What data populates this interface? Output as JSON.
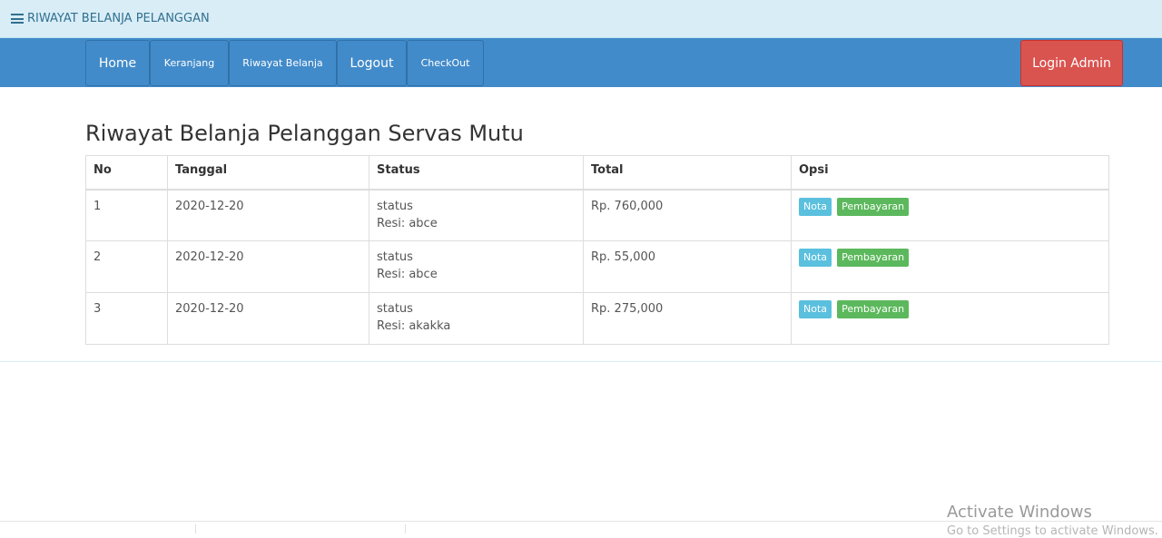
{
  "header": {
    "title": "RIWAYAT BELANJA PELANGGAN"
  },
  "nav": {
    "items": [
      {
        "label": "Home"
      },
      {
        "label": "Keranjang"
      },
      {
        "label": "Riwayat Belanja"
      },
      {
        "label": "Logout"
      },
      {
        "label": "CheckOut"
      }
    ],
    "login_admin": "Login Admin"
  },
  "main": {
    "title": "Riwayat Belanja Pelanggan Servas Mutu",
    "columns": [
      "No",
      "Tanggal",
      "Status",
      "Total",
      "Opsi"
    ],
    "rows": [
      {
        "no": "1",
        "tanggal": "2020-12-20",
        "status": "status",
        "resi": "Resi: abce",
        "total": "Rp. 760,000"
      },
      {
        "no": "2",
        "tanggal": "2020-12-20",
        "status": "status",
        "resi": "Resi: abce",
        "total": "Rp. 55,000"
      },
      {
        "no": "3",
        "tanggal": "2020-12-20",
        "status": "status",
        "resi": "Resi: akakka",
        "total": "Rp. 275,000"
      }
    ],
    "buttons": {
      "nota": "Nota",
      "pembayaran": "Pembayaran"
    }
  },
  "watermark": {
    "title": "Activate Windows",
    "subtitle": "Go to Settings to activate Windows."
  },
  "colors": {
    "navbar": "#428bca",
    "login_admin": "#d9534f",
    "nota": "#5bc0de",
    "pembayaran": "#5cb85c",
    "header_strip": "#d9edf7"
  },
  "icons": {
    "header": "list-icon"
  }
}
